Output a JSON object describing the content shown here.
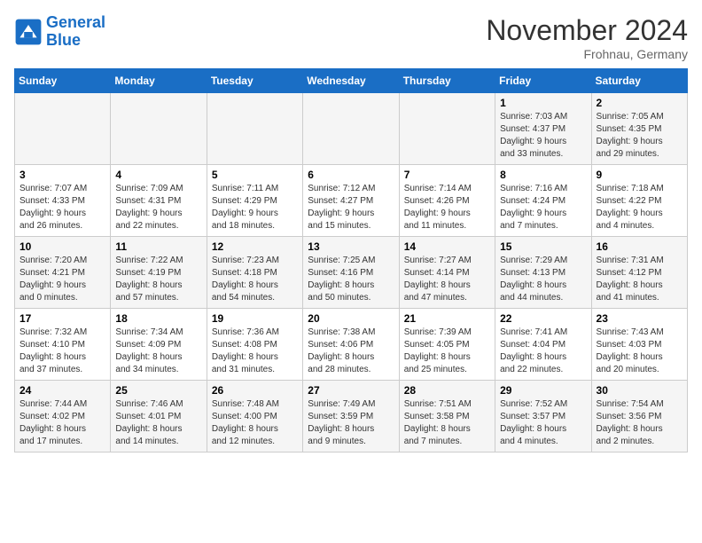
{
  "logo": {
    "line1": "General",
    "line2": "Blue"
  },
  "title": "November 2024",
  "location": "Frohnau, Germany",
  "weekdays": [
    "Sunday",
    "Monday",
    "Tuesday",
    "Wednesday",
    "Thursday",
    "Friday",
    "Saturday"
  ],
  "weeks": [
    [
      {
        "day": "",
        "info": ""
      },
      {
        "day": "",
        "info": ""
      },
      {
        "day": "",
        "info": ""
      },
      {
        "day": "",
        "info": ""
      },
      {
        "day": "",
        "info": ""
      },
      {
        "day": "1",
        "info": "Sunrise: 7:03 AM\nSunset: 4:37 PM\nDaylight: 9 hours\nand 33 minutes."
      },
      {
        "day": "2",
        "info": "Sunrise: 7:05 AM\nSunset: 4:35 PM\nDaylight: 9 hours\nand 29 minutes."
      }
    ],
    [
      {
        "day": "3",
        "info": "Sunrise: 7:07 AM\nSunset: 4:33 PM\nDaylight: 9 hours\nand 26 minutes."
      },
      {
        "day": "4",
        "info": "Sunrise: 7:09 AM\nSunset: 4:31 PM\nDaylight: 9 hours\nand 22 minutes."
      },
      {
        "day": "5",
        "info": "Sunrise: 7:11 AM\nSunset: 4:29 PM\nDaylight: 9 hours\nand 18 minutes."
      },
      {
        "day": "6",
        "info": "Sunrise: 7:12 AM\nSunset: 4:27 PM\nDaylight: 9 hours\nand 15 minutes."
      },
      {
        "day": "7",
        "info": "Sunrise: 7:14 AM\nSunset: 4:26 PM\nDaylight: 9 hours\nand 11 minutes."
      },
      {
        "day": "8",
        "info": "Sunrise: 7:16 AM\nSunset: 4:24 PM\nDaylight: 9 hours\nand 7 minutes."
      },
      {
        "day": "9",
        "info": "Sunrise: 7:18 AM\nSunset: 4:22 PM\nDaylight: 9 hours\nand 4 minutes."
      }
    ],
    [
      {
        "day": "10",
        "info": "Sunrise: 7:20 AM\nSunset: 4:21 PM\nDaylight: 9 hours\nand 0 minutes."
      },
      {
        "day": "11",
        "info": "Sunrise: 7:22 AM\nSunset: 4:19 PM\nDaylight: 8 hours\nand 57 minutes."
      },
      {
        "day": "12",
        "info": "Sunrise: 7:23 AM\nSunset: 4:18 PM\nDaylight: 8 hours\nand 54 minutes."
      },
      {
        "day": "13",
        "info": "Sunrise: 7:25 AM\nSunset: 4:16 PM\nDaylight: 8 hours\nand 50 minutes."
      },
      {
        "day": "14",
        "info": "Sunrise: 7:27 AM\nSunset: 4:14 PM\nDaylight: 8 hours\nand 47 minutes."
      },
      {
        "day": "15",
        "info": "Sunrise: 7:29 AM\nSunset: 4:13 PM\nDaylight: 8 hours\nand 44 minutes."
      },
      {
        "day": "16",
        "info": "Sunrise: 7:31 AM\nSunset: 4:12 PM\nDaylight: 8 hours\nand 41 minutes."
      }
    ],
    [
      {
        "day": "17",
        "info": "Sunrise: 7:32 AM\nSunset: 4:10 PM\nDaylight: 8 hours\nand 37 minutes."
      },
      {
        "day": "18",
        "info": "Sunrise: 7:34 AM\nSunset: 4:09 PM\nDaylight: 8 hours\nand 34 minutes."
      },
      {
        "day": "19",
        "info": "Sunrise: 7:36 AM\nSunset: 4:08 PM\nDaylight: 8 hours\nand 31 minutes."
      },
      {
        "day": "20",
        "info": "Sunrise: 7:38 AM\nSunset: 4:06 PM\nDaylight: 8 hours\nand 28 minutes."
      },
      {
        "day": "21",
        "info": "Sunrise: 7:39 AM\nSunset: 4:05 PM\nDaylight: 8 hours\nand 25 minutes."
      },
      {
        "day": "22",
        "info": "Sunrise: 7:41 AM\nSunset: 4:04 PM\nDaylight: 8 hours\nand 22 minutes."
      },
      {
        "day": "23",
        "info": "Sunrise: 7:43 AM\nSunset: 4:03 PM\nDaylight: 8 hours\nand 20 minutes."
      }
    ],
    [
      {
        "day": "24",
        "info": "Sunrise: 7:44 AM\nSunset: 4:02 PM\nDaylight: 8 hours\nand 17 minutes."
      },
      {
        "day": "25",
        "info": "Sunrise: 7:46 AM\nSunset: 4:01 PM\nDaylight: 8 hours\nand 14 minutes."
      },
      {
        "day": "26",
        "info": "Sunrise: 7:48 AM\nSunset: 4:00 PM\nDaylight: 8 hours\nand 12 minutes."
      },
      {
        "day": "27",
        "info": "Sunrise: 7:49 AM\nSunset: 3:59 PM\nDaylight: 8 hours\nand 9 minutes."
      },
      {
        "day": "28",
        "info": "Sunrise: 7:51 AM\nSunset: 3:58 PM\nDaylight: 8 hours\nand 7 minutes."
      },
      {
        "day": "29",
        "info": "Sunrise: 7:52 AM\nSunset: 3:57 PM\nDaylight: 8 hours\nand 4 minutes."
      },
      {
        "day": "30",
        "info": "Sunrise: 7:54 AM\nSunset: 3:56 PM\nDaylight: 8 hours\nand 2 minutes."
      }
    ]
  ]
}
